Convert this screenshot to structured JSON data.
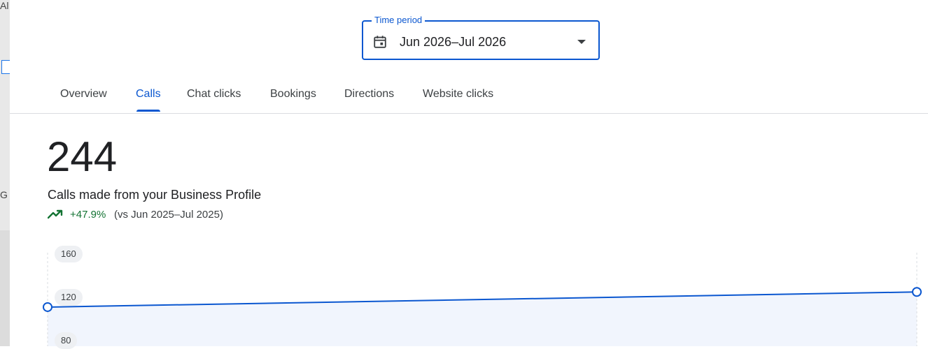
{
  "background": {
    "fragments": [
      "Al",
      "G"
    ]
  },
  "time_period": {
    "label": "Time period",
    "value": "Jun 2026–Jul 2026"
  },
  "tabs": [
    {
      "label": "Overview",
      "active": false
    },
    {
      "label": "Calls",
      "active": true
    },
    {
      "label": "Chat clicks",
      "active": false
    },
    {
      "label": "Bookings",
      "active": false
    },
    {
      "label": "Directions",
      "active": false
    },
    {
      "label": "Website clicks",
      "active": false
    }
  ],
  "metric": {
    "value": "244",
    "description": "Calls made from your Business Profile",
    "change": "+47.9%",
    "comparison": "(vs Jun 2025–Jul 2025)"
  },
  "colors": {
    "accent": "#0b57d0",
    "positive": "#137333",
    "area_fill": "#f1f5fd"
  },
  "chart_data": {
    "type": "line",
    "yticks": [
      "160",
      "120",
      "80"
    ],
    "ylim": [
      80,
      160
    ],
    "series": [
      {
        "values": [
          111,
          125
        ]
      }
    ],
    "grid": false
  }
}
